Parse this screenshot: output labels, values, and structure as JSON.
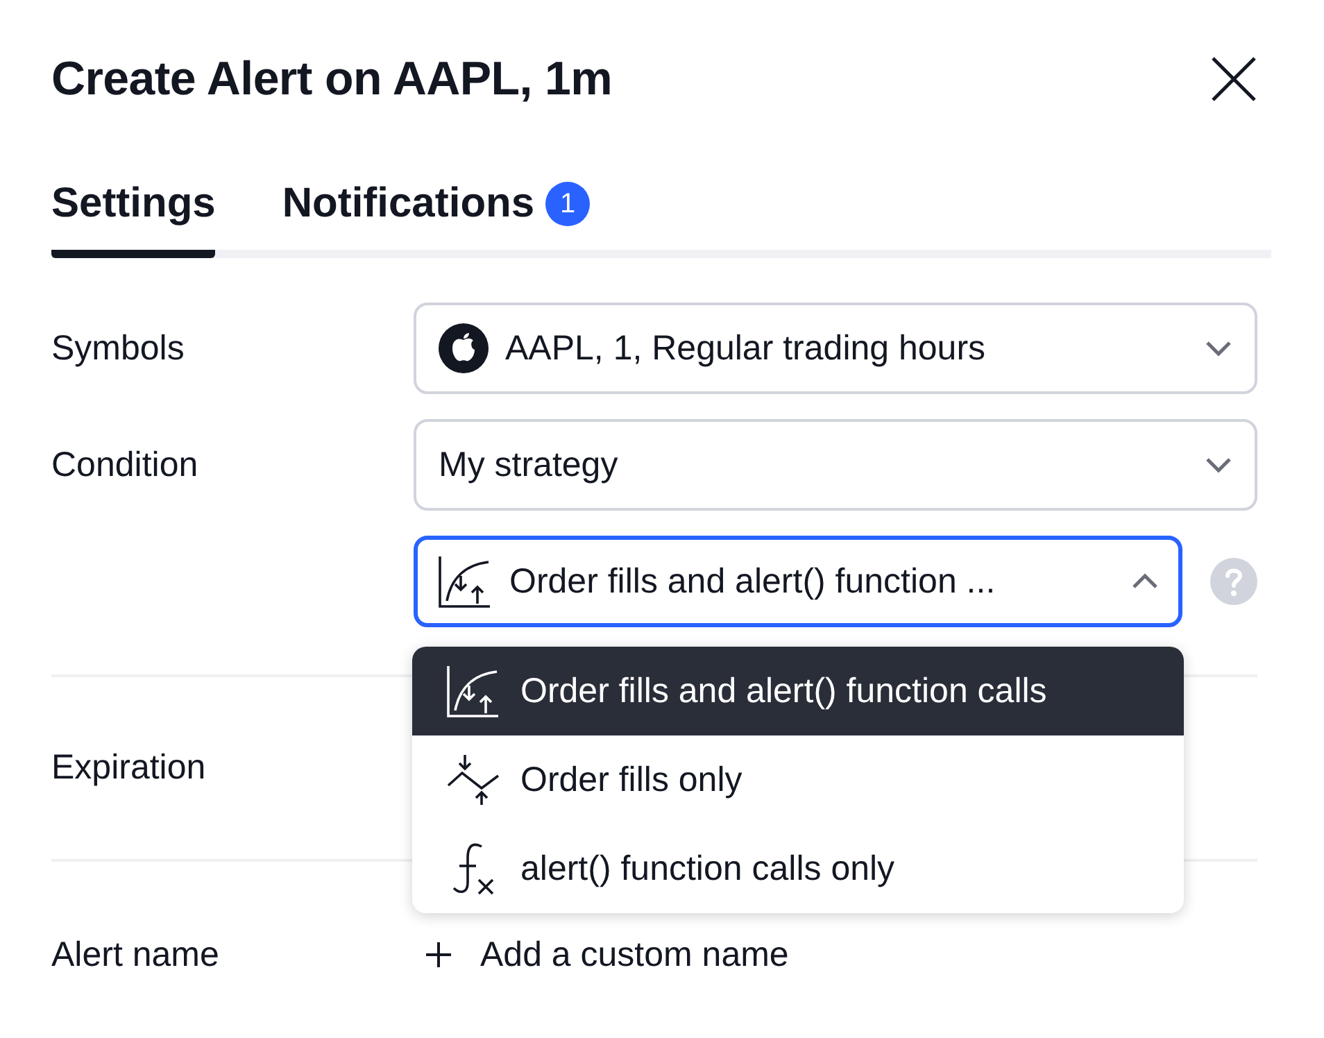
{
  "dialog": {
    "title": "Create Alert on AAPL, 1m"
  },
  "tabs": [
    {
      "label": "Settings",
      "selected": true
    },
    {
      "label": "Notifications",
      "selected": false,
      "badge": "1"
    }
  ],
  "fields": [
    {
      "label": "Symbols",
      "kind": "symbol",
      "value": "AAPL, 1, Regular trading hours"
    },
    {
      "label": "Condition",
      "kind": "select",
      "value": "My strategy"
    },
    {
      "kind": "trigger",
      "value": "Order fills and alert() function ...",
      "expanded": true
    }
  ],
  "trigger_menu": [
    {
      "label": "Order fills and alert() function calls",
      "kind": "fills-and-calls",
      "selected": true
    },
    {
      "label": "Order fills only",
      "kind": "fills",
      "selected": false
    },
    {
      "label": "alert() function calls only",
      "kind": "calls",
      "selected": false
    }
  ],
  "expiration": {
    "label": "Expiration"
  },
  "alert_name": {
    "label": "Alert name",
    "action": "Add a custom name"
  }
}
